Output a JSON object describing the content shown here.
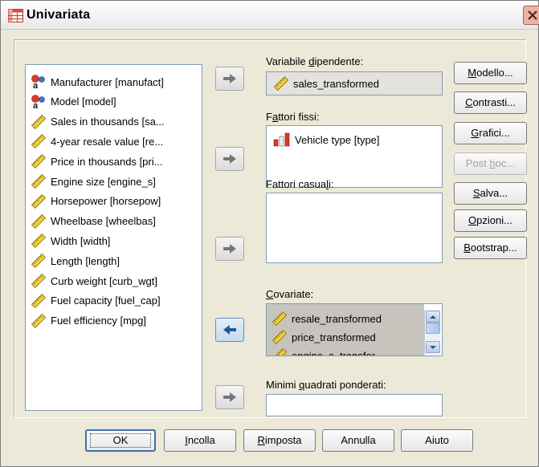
{
  "window": {
    "title": "Univariata"
  },
  "source_list": {
    "items": [
      {
        "label": "Manufacturer [manufact]",
        "icon": "nominal-string-icon"
      },
      {
        "label": "Model [model]",
        "icon": "nominal-string-icon"
      },
      {
        "label": "Sales in thousands [sa...",
        "icon": "scale-ruler-icon"
      },
      {
        "label": "4-year resale value [re...",
        "icon": "scale-ruler-icon"
      },
      {
        "label": "Price in thousands [pri...",
        "icon": "scale-ruler-icon"
      },
      {
        "label": "Engine size [engine_s]",
        "icon": "scale-ruler-icon"
      },
      {
        "label": "Horsepower [horsepow]",
        "icon": "scale-ruler-icon"
      },
      {
        "label": "Wheelbase [wheelbas]",
        "icon": "scale-ruler-icon"
      },
      {
        "label": "Width [width]",
        "icon": "scale-ruler-icon"
      },
      {
        "label": "Length [length]",
        "icon": "scale-ruler-icon"
      },
      {
        "label": "Curb weight [curb_wgt]",
        "icon": "scale-ruler-icon"
      },
      {
        "label": "Fuel capacity [fuel_cap]",
        "icon": "scale-ruler-icon"
      },
      {
        "label": "Fuel efficiency [mpg]",
        "icon": "scale-ruler-icon"
      }
    ]
  },
  "dependent": {
    "label_pre": "Variabile ",
    "label_u": "d",
    "label_post": "ipendente:",
    "value": "sales_transformed"
  },
  "fixed_factors": {
    "label_pre": "F",
    "label_u": "a",
    "label_post": "ttori fissi:",
    "items": [
      {
        "label": "Vehicle type [type]",
        "icon": "nominal-bar-icon"
      }
    ]
  },
  "random_factors": {
    "label_pre": "Fattori casua",
    "label_u": "l",
    "label_post": "i:"
  },
  "covariates": {
    "label_pre": "",
    "label_u": "C",
    "label_post": "ovariate:",
    "items": [
      {
        "label": "resale_transformed"
      },
      {
        "label": "price_transformed"
      },
      {
        "label": "engine_s_transfor"
      }
    ]
  },
  "wls": {
    "label_pre": "Minimi ",
    "label_u": "q",
    "label_post": "uadrati ponderati:",
    "value": ""
  },
  "side_buttons": [
    {
      "pre": "",
      "u": "M",
      "post": "odello...",
      "enabled": true
    },
    {
      "pre": "",
      "u": "C",
      "post": "ontrasti...",
      "enabled": true
    },
    {
      "pre": "",
      "u": "G",
      "post": "rafici...",
      "enabled": true
    },
    {
      "pre": "Post ",
      "u": "h",
      "post": "oc...",
      "enabled": false
    },
    {
      "pre": "",
      "u": "S",
      "post": "alva...",
      "enabled": true
    },
    {
      "pre": "",
      "u": "O",
      "post": "pzioni...",
      "enabled": true
    },
    {
      "pre": "",
      "u": "B",
      "post": "ootstrap...",
      "enabled": true
    }
  ],
  "bottom_buttons": {
    "ok": "OK",
    "paste": {
      "pre": "",
      "u": "I",
      "post": "ncolla"
    },
    "reset": {
      "pre": "",
      "u": "R",
      "post": "imposta"
    },
    "cancel": "Annulla",
    "help": "Aiuto"
  },
  "colors": {
    "accent": "#3d6fb0",
    "selected_item_bg": "#c7c4bd",
    "nominal_icon": "#d93a2b",
    "scale_ruler": "#e6c21a"
  }
}
